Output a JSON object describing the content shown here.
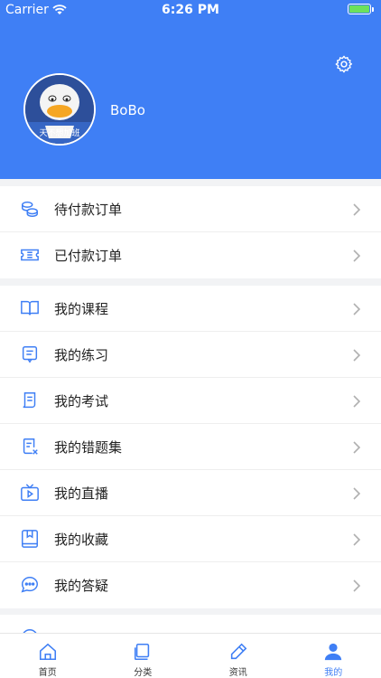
{
  "status_bar": {
    "carrier": "Carrier",
    "time": "6:26 PM"
  },
  "profile": {
    "username": "BoBo",
    "avatar_caption": "天不想加班"
  },
  "group1": [
    {
      "label": "待付款订单",
      "icon": "coins-icon"
    },
    {
      "label": "已付款订单",
      "icon": "ticket-icon"
    }
  ],
  "group2": [
    {
      "label": "我的课程",
      "icon": "book-icon"
    },
    {
      "label": "我的练习",
      "icon": "practice-icon"
    },
    {
      "label": "我的考试",
      "icon": "exam-icon"
    },
    {
      "label": "我的错题集",
      "icon": "wrong-questions-icon"
    },
    {
      "label": "我的直播",
      "icon": "tv-icon"
    },
    {
      "label": "我的收藏",
      "icon": "bookmark-icon"
    },
    {
      "label": "我的答疑",
      "icon": "chat-icon"
    }
  ],
  "tabs": [
    {
      "label": "首页",
      "icon": "home-icon"
    },
    {
      "label": "分类",
      "icon": "category-icon"
    },
    {
      "label": "资讯",
      "icon": "news-icon"
    },
    {
      "label": "我的",
      "icon": "user-icon",
      "active": true
    }
  ],
  "colors": {
    "brand": "#3f7ff5",
    "battery": "#6ce15c"
  }
}
